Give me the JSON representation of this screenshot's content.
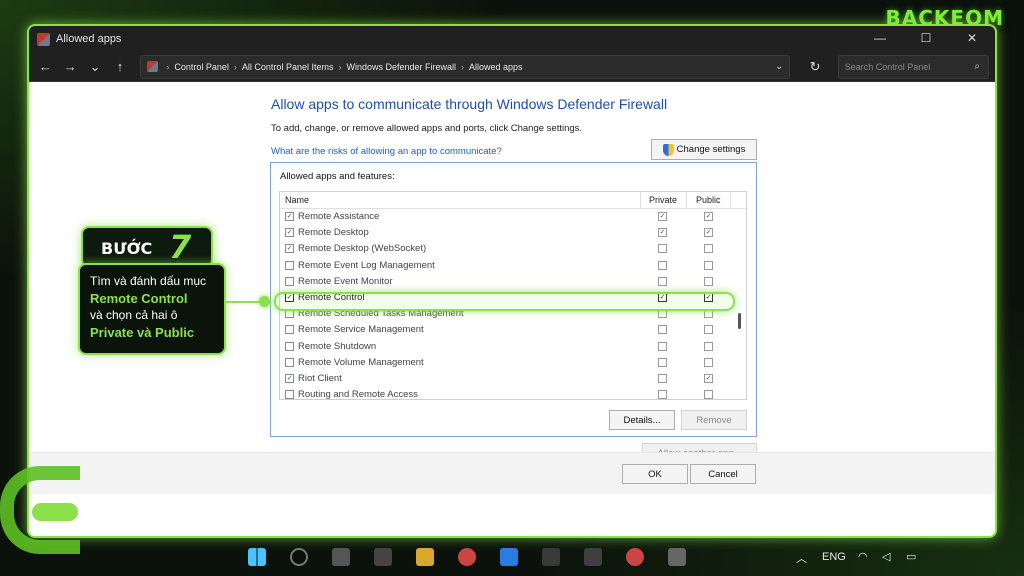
{
  "brand": "BACKEOM",
  "window": {
    "title": "Allowed apps",
    "controls": [
      "—",
      "☐",
      "✕"
    ]
  },
  "nav": {
    "breadcrumbs": [
      "Control Panel",
      "All Control Panel Items",
      "Windows Defender Firewall",
      "Allowed apps"
    ],
    "search_placeholder": "Search Control Panel"
  },
  "page": {
    "heading": "Allow apps to communicate through Windows Defender Firewall",
    "subtext": "To add, change, or remove allowed apps and ports, click Change settings.",
    "risk_link": "What are the risks of allowing an app to communicate?",
    "change_settings": "Change settings",
    "panel_title": "Allowed apps and features:",
    "columns": {
      "name": "Name",
      "private": "Private",
      "public": "Public"
    },
    "rows": [
      {
        "name": "Remote Assistance",
        "checked": true,
        "private": true,
        "public": true
      },
      {
        "name": "Remote Desktop",
        "checked": true,
        "private": true,
        "public": true
      },
      {
        "name": "Remote Desktop (WebSocket)",
        "checked": true,
        "private": false,
        "public": false
      },
      {
        "name": "Remote Event Log Management",
        "checked": false,
        "private": false,
        "public": false
      },
      {
        "name": "Remote Event Monitor",
        "checked": false,
        "private": false,
        "public": false
      },
      {
        "name": "Remote Control",
        "checked": true,
        "private": true,
        "public": true,
        "highlight": true
      },
      {
        "name": "Remote Scheduled Tasks Management",
        "checked": false,
        "private": false,
        "public": false
      },
      {
        "name": "Remote Service Management",
        "checked": false,
        "private": false,
        "public": false
      },
      {
        "name": "Remote Shutdown",
        "checked": false,
        "private": false,
        "public": false
      },
      {
        "name": "Remote Volume Management",
        "checked": false,
        "private": false,
        "public": false
      },
      {
        "name": "Riot Client",
        "checked": true,
        "private": false,
        "public": true
      },
      {
        "name": "Routing and Remote Access",
        "checked": false,
        "private": false,
        "public": false
      }
    ],
    "details_btn": "Details...",
    "remove_btn": "Remove",
    "allow_another_btn": "Allow another app...",
    "ok_btn": "OK",
    "cancel_btn": "Cancel"
  },
  "callout": {
    "step_word": "BƯỚC",
    "step_num": "7",
    "line1": "Tìm và đánh dấu mục",
    "line2": "Remote Control",
    "line3": "và chọn cả hai ô",
    "line4": "Private và Public"
  },
  "taskbar": {
    "lang": "ENG"
  },
  "colors": {
    "accent": "#8ce04a",
    "link": "#1f5fc0",
    "heading": "#1f4fa8"
  }
}
